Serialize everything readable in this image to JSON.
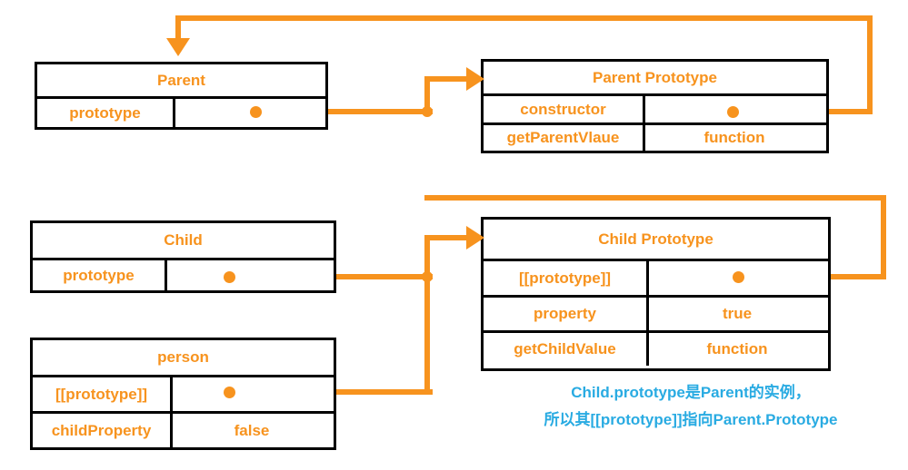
{
  "diagram": {
    "title": "JavaScript prototype chain diagram",
    "colors": {
      "accent": "#F7931E",
      "box_border": "#000000",
      "caption": "#29ABE2",
      "background": "#FFFFFF"
    },
    "boxes": [
      {
        "id": "parent",
        "title": "Parent",
        "rows": [
          {
            "key": "prototype",
            "value": ""
          }
        ]
      },
      {
        "id": "parent-prototype",
        "title": "Parent Prototype",
        "rows": [
          {
            "key": "constructor",
            "value": ""
          },
          {
            "key": "getParentVlaue",
            "value": "function"
          }
        ]
      },
      {
        "id": "child",
        "title": "Child",
        "rows": [
          {
            "key": "prototype",
            "value": ""
          }
        ]
      },
      {
        "id": "child-prototype",
        "title": "Child Prototype",
        "rows": [
          {
            "key": "[[prototype]]",
            "value": ""
          },
          {
            "key": "property",
            "value": "true"
          },
          {
            "key": "getChildValue",
            "value": "function"
          }
        ]
      },
      {
        "id": "person",
        "title": "person",
        "rows": [
          {
            "key": "[[prototype]]",
            "value": ""
          },
          {
            "key": "childProperty",
            "value": "false"
          }
        ]
      }
    ],
    "caption": {
      "line1": "Child.prototype是Parent的实例，",
      "line2": "所以其[[prototype]]指向Parent.Prototype"
    }
  }
}
